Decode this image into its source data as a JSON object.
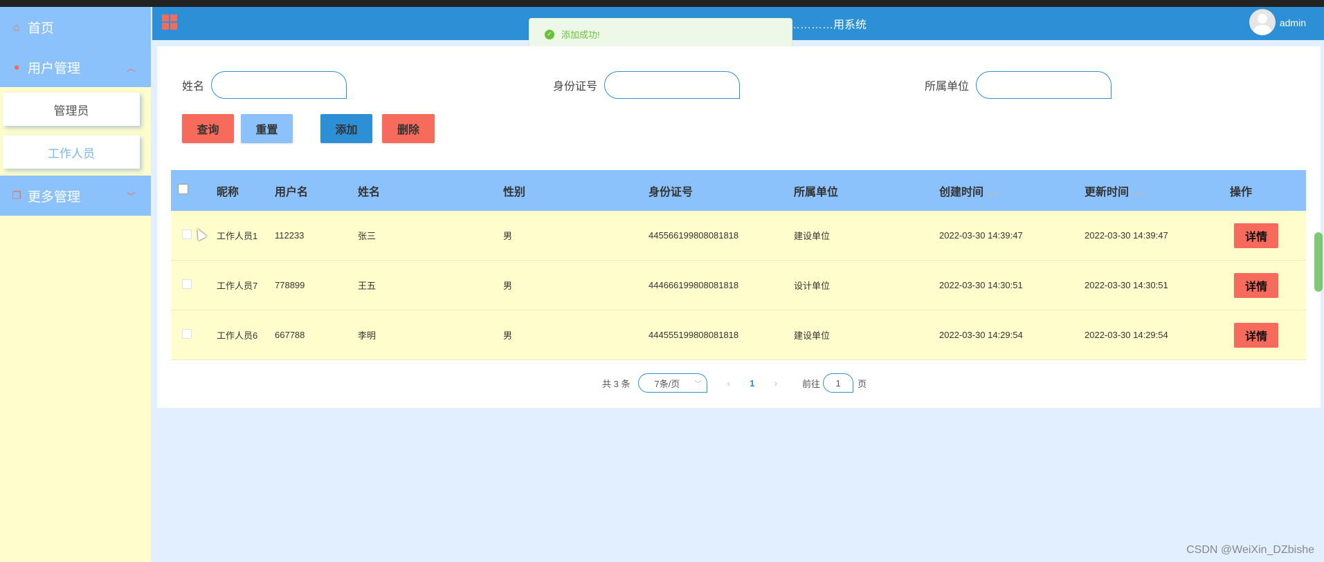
{
  "sidebar": {
    "home_label": "首页",
    "user_mgmt_label": "用户管理",
    "sub_items": [
      "管理员",
      "工作人员"
    ],
    "more_mgmt_label": "更多管理"
  },
  "header": {
    "title": "…………用系统",
    "username": "admin"
  },
  "toast": {
    "message": "添加成功!"
  },
  "search": {
    "name_label": "姓名",
    "id_label": "身份证号",
    "unit_label": "所属单位",
    "name_value": "",
    "id_value": "",
    "unit_value": ""
  },
  "buttons": {
    "query": "查询",
    "reset": "重置",
    "add": "添加",
    "delete": "删除"
  },
  "table": {
    "headers": [
      "昵称",
      "用户名",
      "姓名",
      "性别",
      "身份证号",
      "所属单位",
      "创建时间",
      "更新时间",
      "操作"
    ],
    "rows": [
      [
        "工作人员1",
        "112233",
        "张三",
        "男",
        "445566199808081818",
        "建设单位",
        "2022-03-30 14:39:47",
        "2022-03-30 14:39:47",
        "详情"
      ],
      [
        "工作人员7",
        "778899",
        "王五",
        "男",
        "444666199808081818",
        "设计单位",
        "2022-03-30 14:30:51",
        "2022-03-30 14:30:51",
        "详情"
      ],
      [
        "工作人员6",
        "667788",
        "李明",
        "男",
        "444555199808081818",
        "建设单位",
        "2022-03-30 14:29:54",
        "2022-03-30 14:29:54",
        "详情"
      ]
    ]
  },
  "pagination": {
    "total": "共 3 条",
    "page_size": "7条/页",
    "current_page": "1",
    "goto_label": "前往",
    "goto_value": "1",
    "goto_unit": "页"
  },
  "colors": {
    "header": "#2d8fd5",
    "sidebar_head": "#8cc2fb",
    "sidebar_bg": "#fffdcb",
    "accent_red": "#f66b5c",
    "success": "#67c23a"
  },
  "watermark": "CSDN @WeiXin_DZbishe"
}
